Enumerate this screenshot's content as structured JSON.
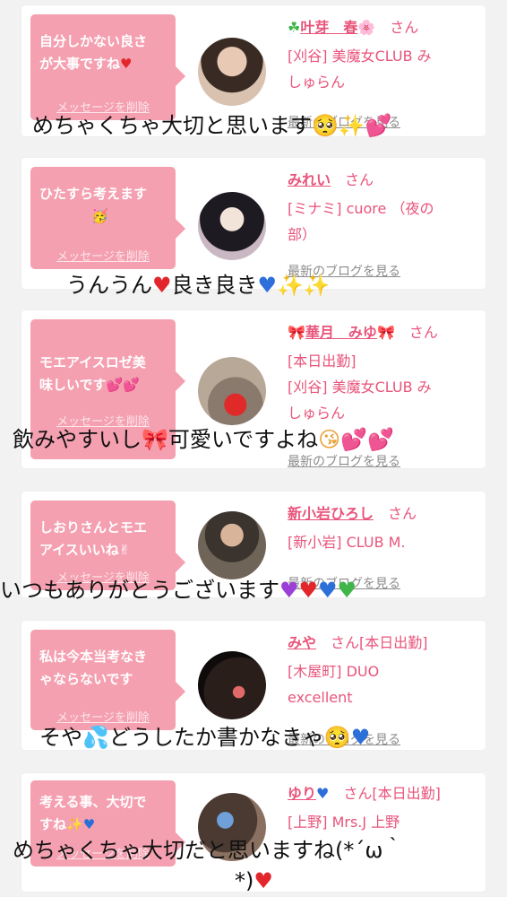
{
  "delete_label": "メッセージを削除",
  "blog_label": "最新のブログを見る",
  "san_suffix": "さん",
  "entries": [
    {
      "message_line1": "自分しかない良さ",
      "message_line2": "が大事ですね",
      "name_prefix": "☘",
      "name": "叶芽　春",
      "name_suffix": "🌸",
      "status": "",
      "line1": "[刈谷] 美魔女CLUB み",
      "line2": "しゅらん",
      "line3": "",
      "comment": "めちゃくちゃ大切と思います",
      "comment2": ""
    },
    {
      "message_line1": "ひたすら考えます",
      "message_line2": "🥳",
      "name_prefix": "",
      "name": "みれい",
      "name_suffix": "",
      "status": "",
      "line1": "[ミナミ] cuore （夜の",
      "line2": "部）",
      "line3": "",
      "comment": "うんうん",
      "comment2": "良き良き"
    },
    {
      "message_line1": "モエアイスロゼ美",
      "message_line2": "味しいです",
      "name_prefix": "🎀",
      "name": "華月　みゆ",
      "name_suffix": "🎀",
      "status": "",
      "line1": "[本日出勤]",
      "line2": "[刈谷] 美魔女CLUB み",
      "line3": "しゅらん",
      "comment": "飲みやすいし",
      "comment2": "可愛いですよね"
    },
    {
      "message_line1": "しおりさんとモエ",
      "message_line2": "アイスいいね✌",
      "name_prefix": "",
      "name": "新小岩ひろし",
      "name_suffix": "",
      "status": "",
      "line1": "[新小岩] CLUB M.",
      "line2": "",
      "line3": "",
      "comment": "いつもありがとうございます",
      "comment2": ""
    },
    {
      "message_line1": "私は今本当考なき",
      "message_line2": "ゃならないです",
      "name_prefix": "",
      "name": "みや",
      "name_suffix": "",
      "status": "[本日出勤]",
      "line1": "[木屋町] DUO",
      "line2": "excellent",
      "line3": "",
      "comment": "そや",
      "comment2": "どうしたか書かなきゃ"
    },
    {
      "message_line1": "考える事、大切で",
      "message_line2": "すね",
      "name_prefix": "",
      "name": "ゆり",
      "name_suffix": "",
      "status": "[本日出勤]",
      "line1": "[上野] Mrs.J 上野",
      "line2": "",
      "line3": "",
      "comment": "めちゃくちゃ大切だと思いますね(*´ω｀",
      "comment2": "*)"
    }
  ]
}
